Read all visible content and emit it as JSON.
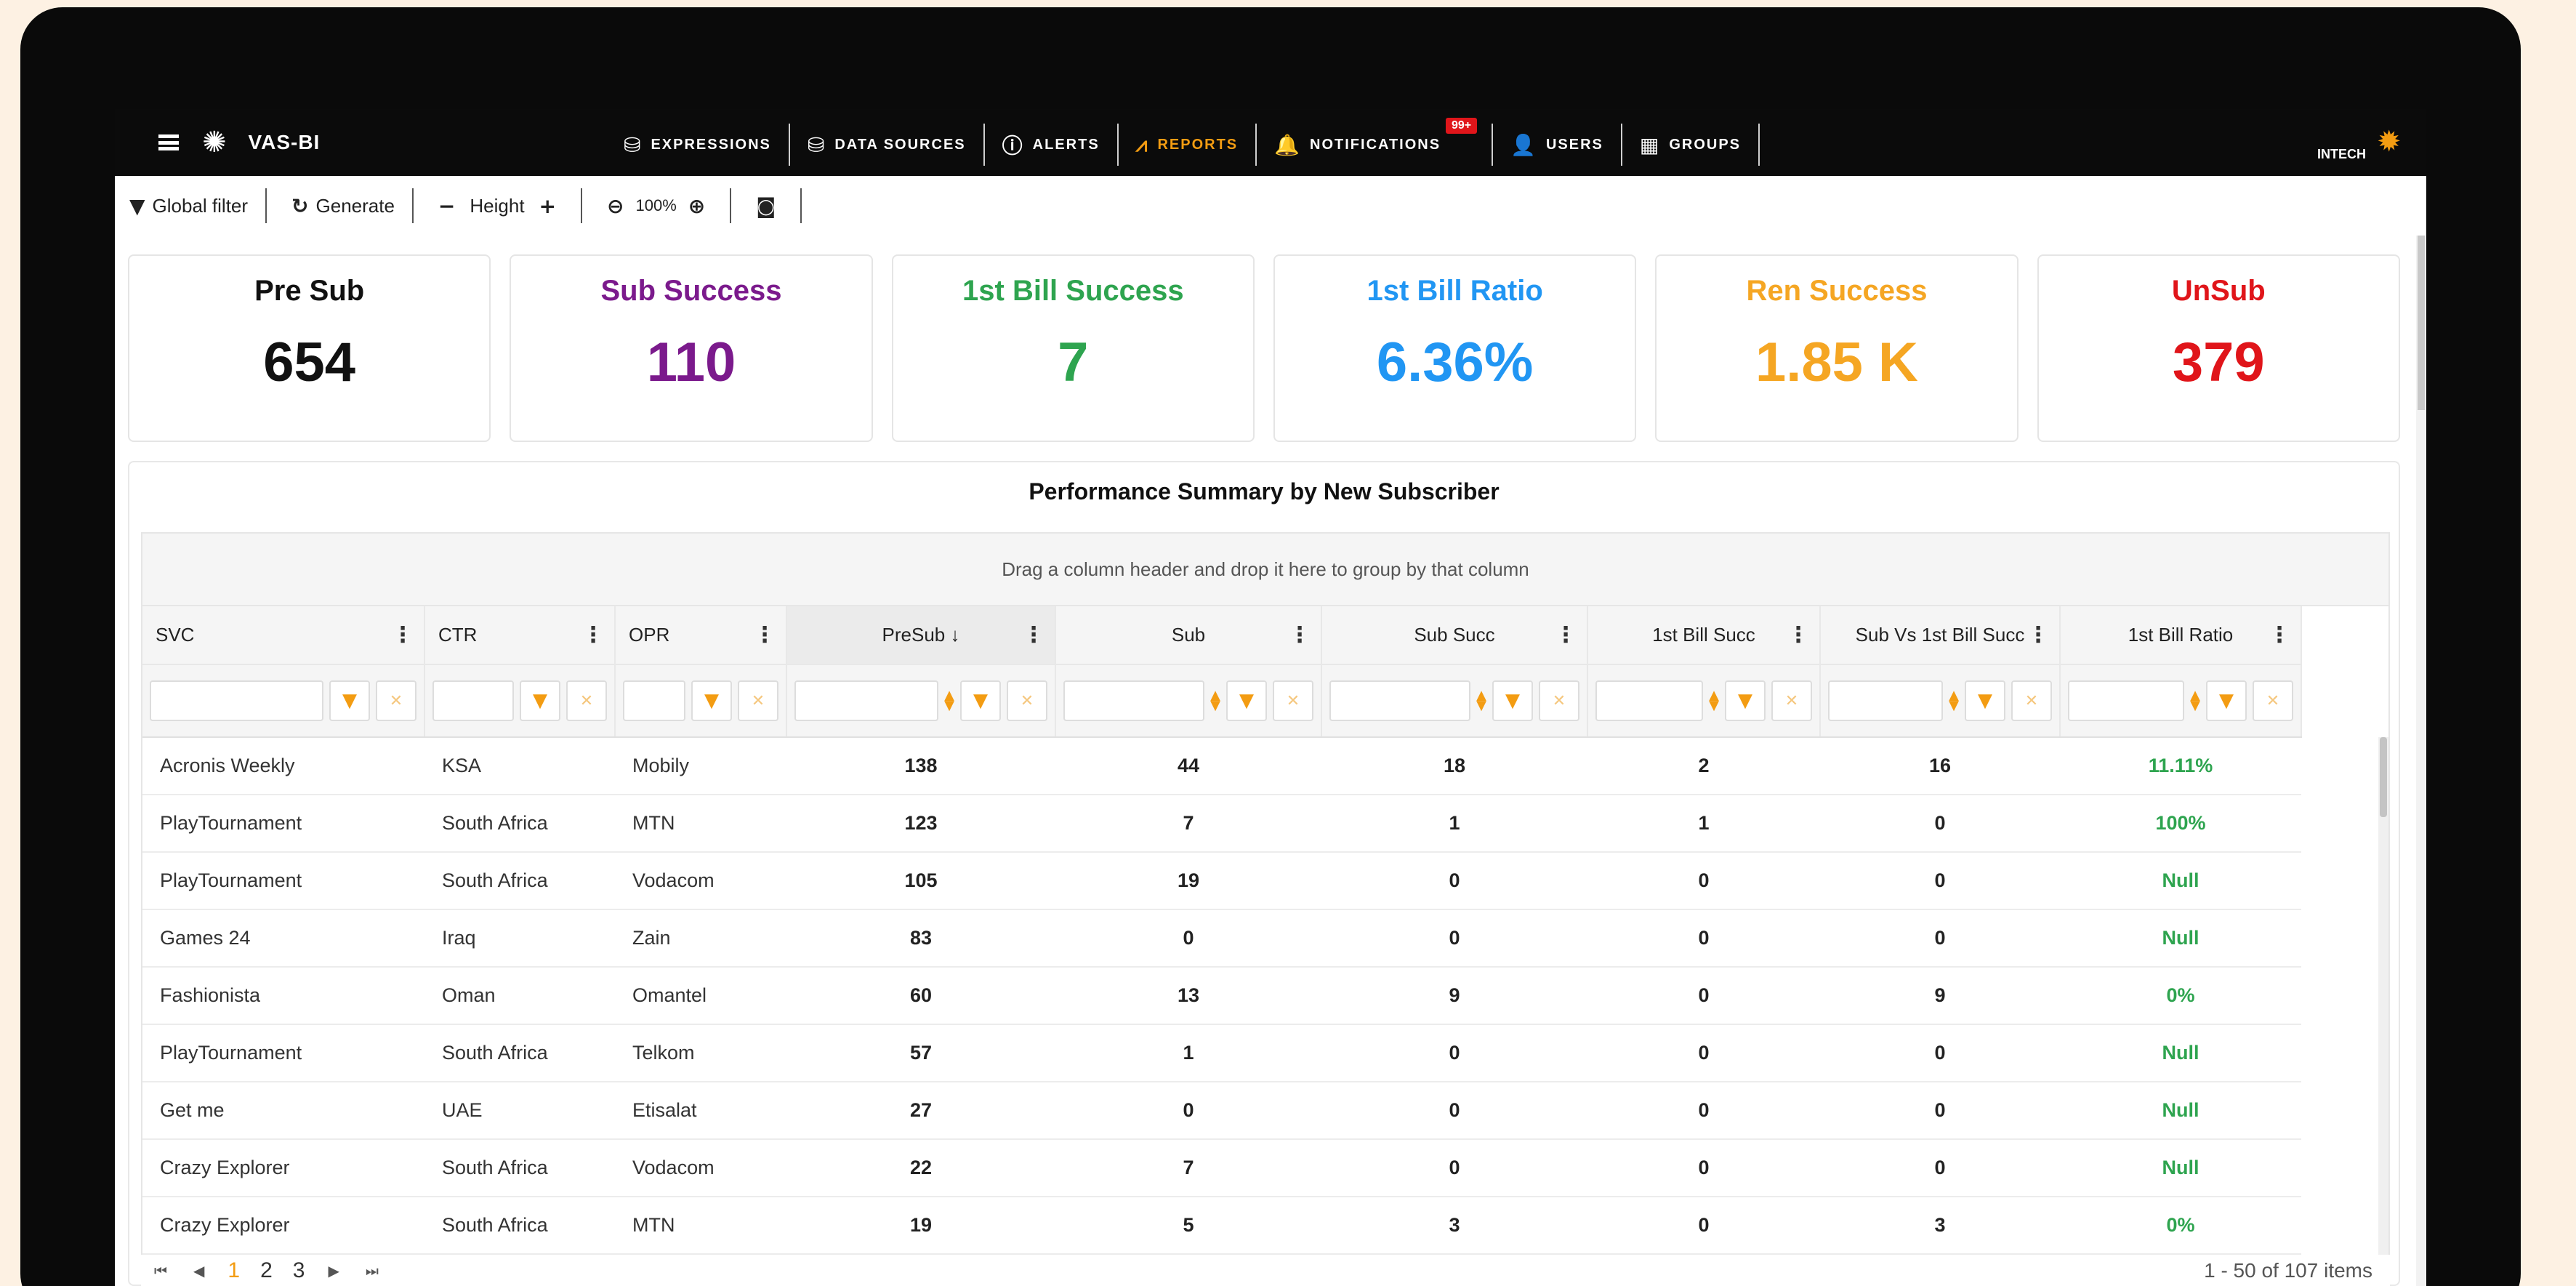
{
  "navbar": {
    "brand": "VAS-BI",
    "items": [
      {
        "label": "EXPRESSIONS",
        "icon": "database-sql-icon",
        "glyph": "⛁"
      },
      {
        "label": "DATA SOURCES",
        "icon": "database-icon",
        "glyph": "⛁"
      },
      {
        "label": "ALERTS",
        "icon": "alert-circle-icon",
        "glyph": "ⓘ"
      },
      {
        "label": "REPORTS",
        "icon": "chart-icon",
        "glyph": "⩘"
      },
      {
        "label": "NOTIFICATIONS",
        "icon": "bell-icon",
        "glyph": "🔔",
        "badge": "99+"
      },
      {
        "label": "USERS",
        "icon": "user-icon",
        "glyph": "👤"
      },
      {
        "label": "GROUPS",
        "icon": "grid-icon",
        "glyph": "▦"
      }
    ],
    "active": "REPORTS",
    "user": "INTECH",
    "accent": "#f39c12"
  },
  "toolbar": {
    "global_filter": "Global filter",
    "generate": "Generate",
    "height": "Height",
    "zoom": "100%"
  },
  "kpis": [
    {
      "label": "Pre Sub",
      "value": "654",
      "color": "#111111"
    },
    {
      "label": "Sub Success",
      "value": "110",
      "color": "#7b1a8c"
    },
    {
      "label": "1st Bill Success",
      "value": "7",
      "color": "#2ea44f"
    },
    {
      "label": "1st Bill Ratio",
      "value": "6.36%",
      "color": "#2196f3"
    },
    {
      "label": "Ren Success",
      "value": "1.85 K",
      "color": "#f5a623"
    },
    {
      "label": "UnSub",
      "value": "379",
      "color": "#e0151a"
    }
  ],
  "grid": {
    "title": "Performance Summary by New Subscriber",
    "group_hint": "Drag a column header and drop it here to group by that column",
    "columns": [
      "SVC",
      "CTR",
      "OPR",
      "PreSub ↓",
      "Sub",
      "Sub Succ",
      "1st Bill Succ",
      "Sub Vs 1st Bill Succ",
      "1st Bill Ratio"
    ],
    "rows": [
      [
        "Acronis Weekly",
        "KSA",
        "Mobily",
        "138",
        "44",
        "18",
        "2",
        "16",
        "11.11%"
      ],
      [
        "PlayTournament",
        "South Africa",
        "MTN",
        "123",
        "7",
        "1",
        "1",
        "0",
        "100%"
      ],
      [
        "PlayTournament",
        "South Africa",
        "Vodacom",
        "105",
        "19",
        "0",
        "0",
        "0",
        "Null"
      ],
      [
        "Games 24",
        "Iraq",
        "Zain",
        "83",
        "0",
        "0",
        "0",
        "0",
        "Null"
      ],
      [
        "Fashionista",
        "Oman",
        "Omantel",
        "60",
        "13",
        "9",
        "0",
        "9",
        "0%"
      ],
      [
        "PlayTournament",
        "South Africa",
        "Telkom",
        "57",
        "1",
        "0",
        "0",
        "0",
        "Null"
      ],
      [
        "Get me",
        "UAE",
        "Etisalat",
        "27",
        "0",
        "0",
        "0",
        "0",
        "Null"
      ],
      [
        "Crazy Explorer",
        "South Africa",
        "Vodacom",
        "22",
        "7",
        "0",
        "0",
        "0",
        "Null"
      ],
      [
        "Crazy Explorer",
        "South Africa",
        "MTN",
        "19",
        "5",
        "3",
        "0",
        "3",
        "0%"
      ]
    ],
    "pager": {
      "pages": [
        "1",
        "2",
        "3"
      ],
      "current": "1",
      "info": "1 - 50 of 107 items"
    }
  }
}
